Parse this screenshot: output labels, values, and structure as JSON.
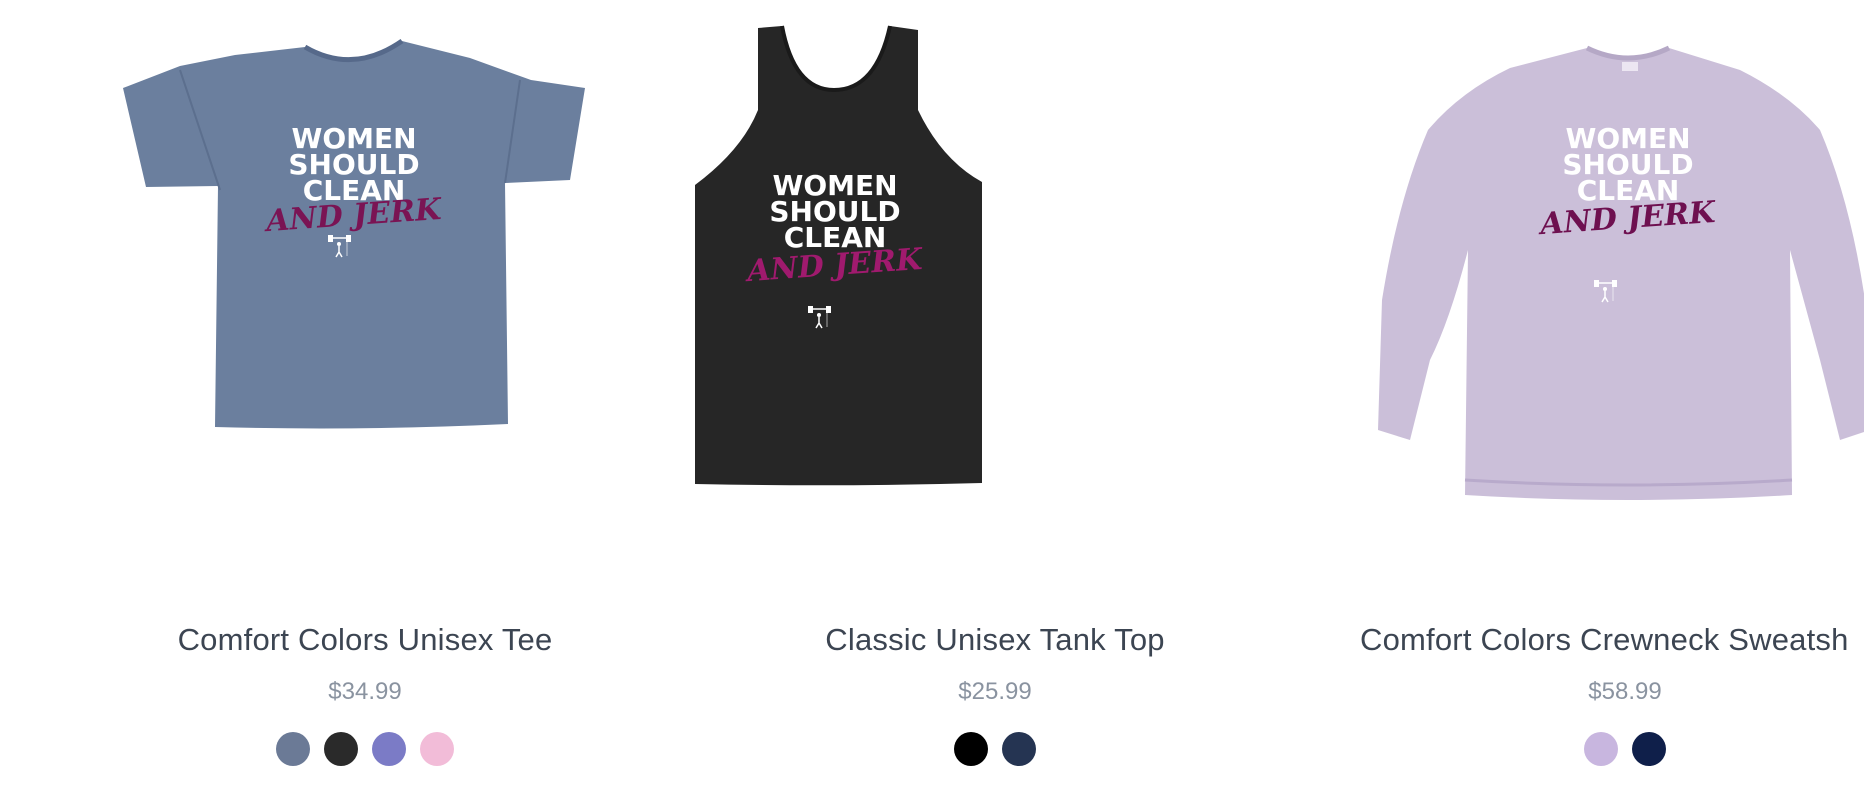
{
  "products": [
    {
      "title": "Comfort Colors Unisex Tee",
      "price": "$34.99",
      "garment": "tee",
      "garment_color": "#6b7f9e",
      "graphic": {
        "line1": "WOMEN",
        "line2": "SHOULD",
        "line3": "CLEAN",
        "script": "AND JERK",
        "script_color": "#7a1454"
      },
      "swatches": [
        "#6b7a96",
        "#2a2a2a",
        "#7b7bc6",
        "#f2bcd8"
      ]
    },
    {
      "title": "Classic Unisex Tank Top",
      "price": "$25.99",
      "garment": "tank",
      "garment_color": "#262626",
      "graphic": {
        "line1": "WOMEN",
        "line2": "SHOULD",
        "line3": "CLEAN",
        "script": "AND JERK",
        "script_color": "#a01a6e"
      },
      "swatches": [
        "#000000",
        "#253452"
      ]
    },
    {
      "title": "Comfort Colors Crewneck Sweatsh",
      "price": "$58.99",
      "garment": "crewneck",
      "garment_color": "#cbbfd9",
      "graphic": {
        "line1": "WOMEN",
        "line2": "SHOULD",
        "line3": "CLEAN",
        "script": "AND JERK",
        "script_color": "#6e1050"
      },
      "swatches": [
        "#c8b6df",
        "#0f1f4a"
      ]
    }
  ]
}
